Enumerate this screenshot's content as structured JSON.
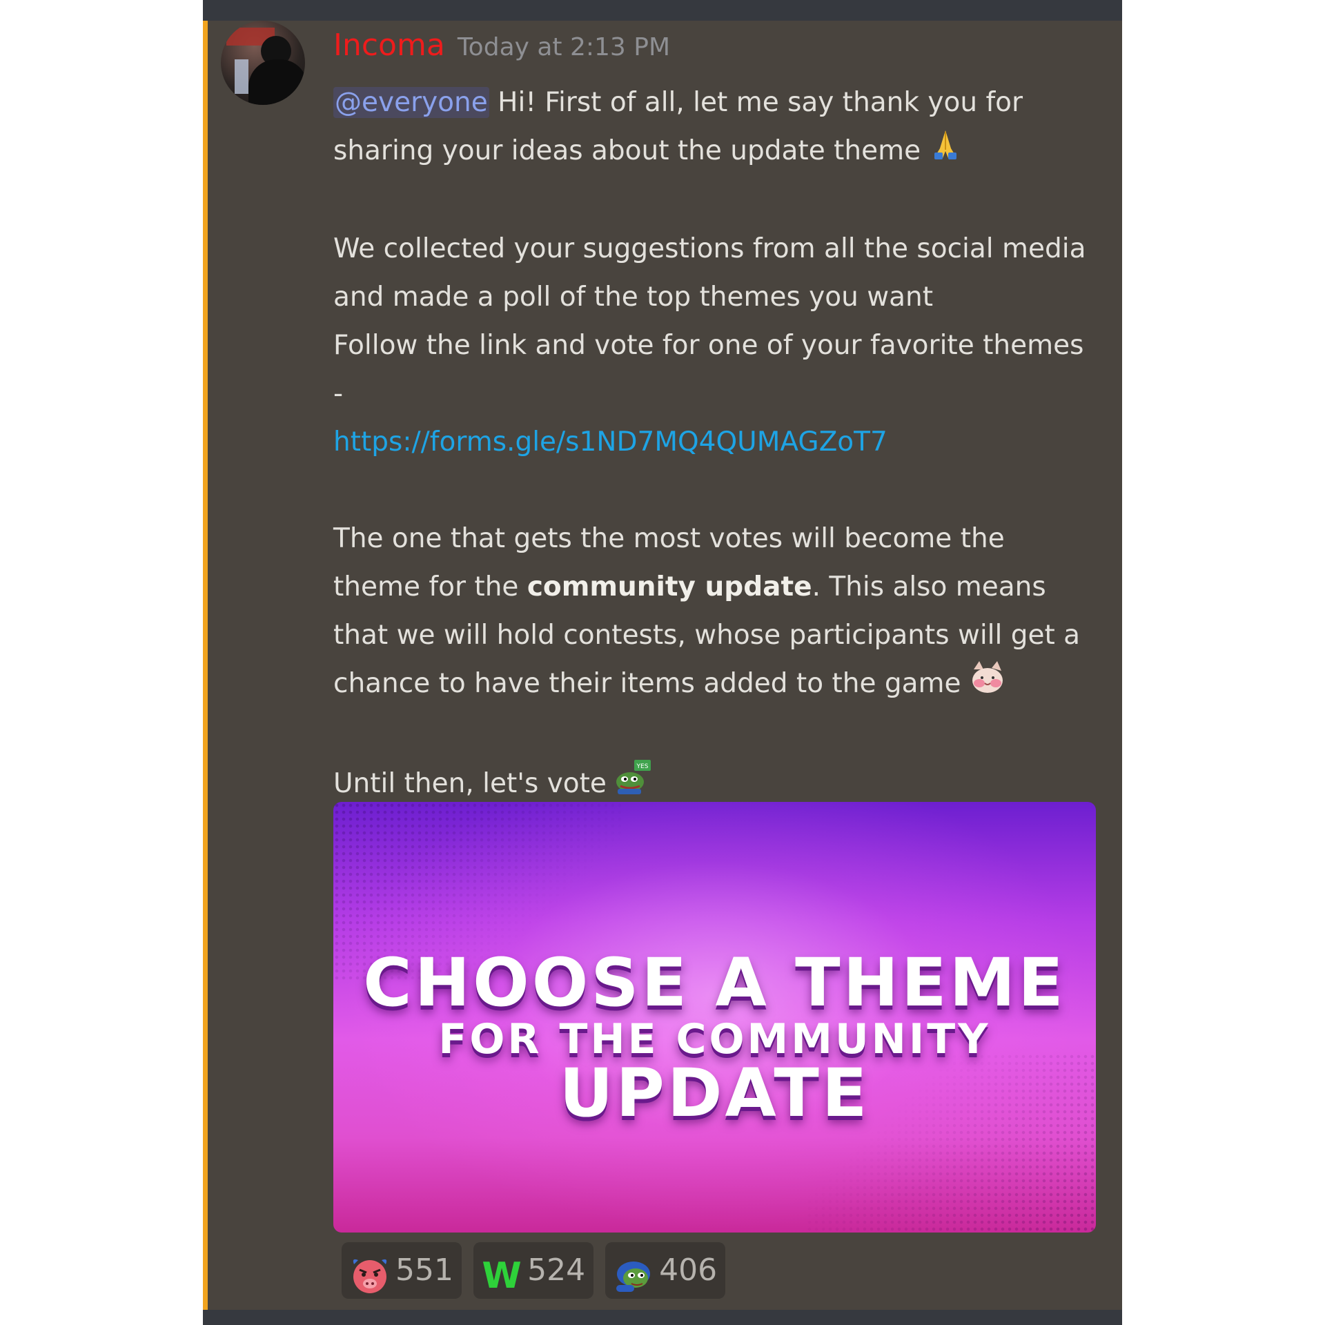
{
  "message": {
    "username": "Incoma",
    "timestamp": "Today at 2:13 PM",
    "mention": "@everyone",
    "para1_text": " Hi! First of all, let me say thank you for sharing your ideas about the update theme ",
    "para2_line1": "We collected your suggestions from all the social media and made a poll of the top themes you want",
    "para2_line2": "Follow the link and vote for one of your favorite themes -",
    "link": "https://forms.gle/s1ND7MQ4QUMAGZoT7",
    "para3_before": "The one that gets the most votes will become the theme for the ",
    "para3_bold": "community update",
    "para3_after": ". This also means that we will hold contests, whose participants will get a chance to have their items added to the game ",
    "para4_text": "Until then, let's vote ",
    "emoji_yes_label": "YES"
  },
  "embed": {
    "line1": "CHOOSE A THEME",
    "line2": "FOR THE COMMUNITY",
    "line3": "UPDATE"
  },
  "reactions": [
    {
      "icon": "angry-pig-icon",
      "count": "551"
    },
    {
      "icon": "w-letter-icon",
      "label": "W",
      "count": "524"
    },
    {
      "icon": "pepe-hug-icon",
      "count": "406"
    }
  ],
  "colors": {
    "username": "#ee1c1c",
    "link": "#1ea4e5",
    "mention": "#8aa1ec",
    "mention_bar": "#f0a31f",
    "message_bg": "#49443e"
  }
}
